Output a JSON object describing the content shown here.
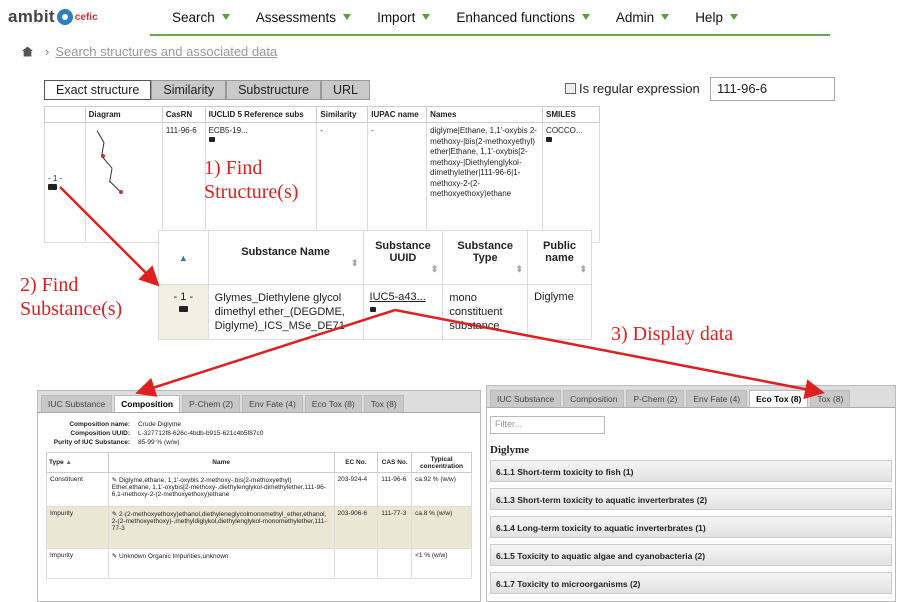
{
  "app": {
    "logo_text": "ambit",
    "logo_sub": "cefic"
  },
  "nav": {
    "items": [
      "Search",
      "Assessments",
      "Import",
      "Enhanced functions",
      "Admin",
      "Help"
    ]
  },
  "breadcrumb": {
    "link": "Search structures and associated data"
  },
  "search": {
    "tabs": [
      "Exact structure",
      "Similarity",
      "Substructure",
      "URL"
    ],
    "active_tab": "Exact structure",
    "regex_label": "Is regular expression",
    "query": "111-96-6"
  },
  "structure_table": {
    "headers": [
      "",
      "Diagram",
      "CasRN",
      "IUCLID 5 Reference subs",
      "Similarity",
      "IUPAC name",
      "Names",
      "SMILES"
    ],
    "row": {
      "index": "- 1 -",
      "casrn": "111-96-6",
      "iuclid": "ECB5-19...",
      "similarity": "-",
      "iupac": "-",
      "names": "diglyme|Ethane, 1,1'-oxybis 2-methoxy-|bis(2-methoxyethyl) ether|Ethane, 1,1'-oxybis[2-methoxy-|Diethylenglykol-dimethylether|111-96-6|1-methoxy-2-(2-methoxyethoxy)ethane",
      "smiles": "COCCO..."
    }
  },
  "substance_table": {
    "headers": [
      "Substance Name",
      "Substance UUID",
      "Substance Type",
      "Public name"
    ],
    "row": {
      "index": "- 1 -",
      "name": "Glymes_Diethylene glycol dimethyl ether_(DEGDME, Diglyme)_ICS_MSe_DE71",
      "uuid": "IUC5-a43...",
      "type": "mono constituent substance",
      "public_name": "Diglyme"
    }
  },
  "annotations": {
    "find_structure": "1) Find Structure(s)",
    "find_substance": "2) Find Substance(s)",
    "display_data": "3) Display data"
  },
  "composition_panel": {
    "tabs": [
      "IUC Substance",
      "Composition",
      "P-Chem (2)",
      "Env Fate (4)",
      "Eco Tox (8)",
      "Tox (8)"
    ],
    "active_tab": "Composition",
    "meta": [
      {
        "k": "Composition name:",
        "v": "Crude Diglyme"
      },
      {
        "k": "Composition UUID:",
        "v": "L-327712f8-626c-4bdb-b915-621c4b5f87c0"
      },
      {
        "k": "Purity of IUC Substance:",
        "v": "85-99 % (w/w)"
      }
    ],
    "headers": [
      "Type",
      "Name",
      "EC No.",
      "CAS No.",
      "Typical concentration"
    ],
    "rows": [
      {
        "type": "Constituent",
        "name": "Diglyme,ethane, 1,1'-oxybis 2-methoxy-,bis(2-methoxyethyl) Ether,ethane, 1,1'-oxybis[2-methoxy-,diethylenglykol-dimethylether,111-96-6,1-methoxy-2-(2-methoxyethoxy)ethane",
        "ec": "203-924-4",
        "cas": "111-96-6",
        "conc": "ca.92 % (w/w)"
      },
      {
        "type": "Impurity",
        "name": "2-(2-methoxyethoxy)ethanol,diethyleneglycolmonomethyl_ether,ethanol, 2-(2-methoxyethoxy)-,methyldiglykol,diethylenglykol-monomethylether,111-77-3",
        "ec": "203-906-6",
        "cas": "111-77-3",
        "conc": "ca.8 % (w/w)"
      },
      {
        "type": "Impurity",
        "name": "Unknown Organic Impurities,unknown",
        "ec": "",
        "cas": "",
        "conc": "<1 % (w/w)"
      }
    ]
  },
  "ecotox_panel": {
    "tabs": [
      "IUC Substance",
      "Composition",
      "P-Chem (2)",
      "Env Fate (4)",
      "Eco Tox (8)",
      "Tox (8)"
    ],
    "active_tab": "Eco Tox (8)",
    "filter_placeholder": "Filter...",
    "title": "Diglyme",
    "endpoints": [
      "6.1.1 Short-term toxicity to fish (1)",
      "6.1.3 Short-term toxicity to aquatic inverterbrates (2)",
      "6.1.4 Long-term toxicity to aquatic inverterbrates (1)",
      "6.1.5 Toxicity to aquatic algae and cyanobacteria (2)",
      "6.1.7 Toxicity to microorganisms (2)"
    ]
  },
  "colors": {
    "annotation": "#e02020",
    "nav_accent": "#6aa84f",
    "impurity_row": "#ece6d5"
  }
}
